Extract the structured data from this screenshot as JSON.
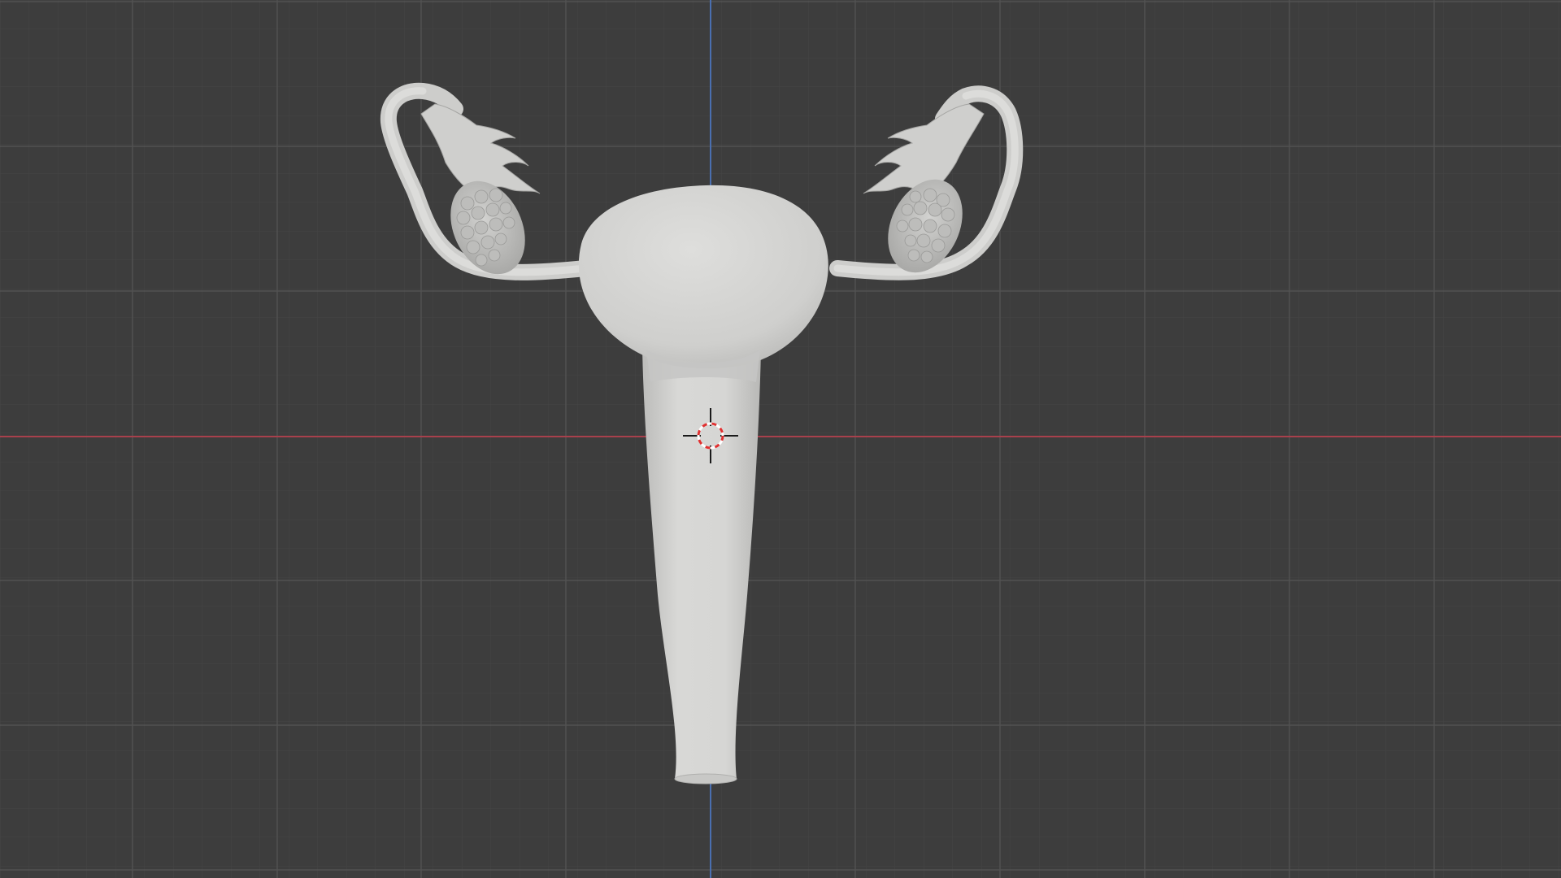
{
  "app": "3D viewport",
  "viewport": {
    "background_color": "#3d3d3d",
    "minor_grid_color": "#444444",
    "major_grid_color": "#525252",
    "x_axis_color": "#a8404c",
    "y_axis_color": "#4a6fb0",
    "mesh_color": "#d4d4d2",
    "mesh_shade_color": "#b8b8b6",
    "cursor_ring_colors": [
      "#e03030",
      "#ffffff"
    ],
    "cursor_cross_color": "#1a1a1a"
  },
  "scene": {
    "object": "uterus-model",
    "cursor_icon": "3d-cursor-icon"
  }
}
